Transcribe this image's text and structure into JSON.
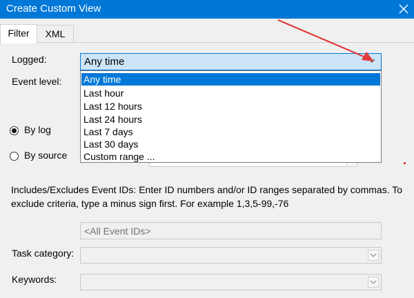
{
  "window": {
    "title": "Create Custom View",
    "close_icon": "close-icon"
  },
  "tabs": [
    {
      "label": "Filter",
      "active": true
    },
    {
      "label": "XML",
      "active": false
    }
  ],
  "logged": {
    "label": "Logged:",
    "value": "Any time",
    "options": [
      "Any time",
      "Last hour",
      "Last 12 hours",
      "Last 24 hours",
      "Last 7 days",
      "Last 30 days",
      "Custom range ..."
    ],
    "selected_index": 0
  },
  "event_level": {
    "label": "Event level:"
  },
  "filter_by": {
    "by_log": "By log",
    "by_source": "By source",
    "selected": "by_log"
  },
  "event_ids": {
    "description": "Includes/Excludes Event IDs: Enter ID numbers and/or ID ranges separated by commas. To exclude criteria, type a minus sign first. For example 1,3,5-99,-76",
    "placeholder": "<All Event IDs>"
  },
  "task_category": {
    "label": "Task category:"
  },
  "keywords": {
    "label": "Keywords:"
  },
  "colors": {
    "title_bar": "#0078d7",
    "selection": "#0078d7",
    "combo_highlight": "#cce4f7",
    "annotation_arrow": "#e03b3b"
  }
}
